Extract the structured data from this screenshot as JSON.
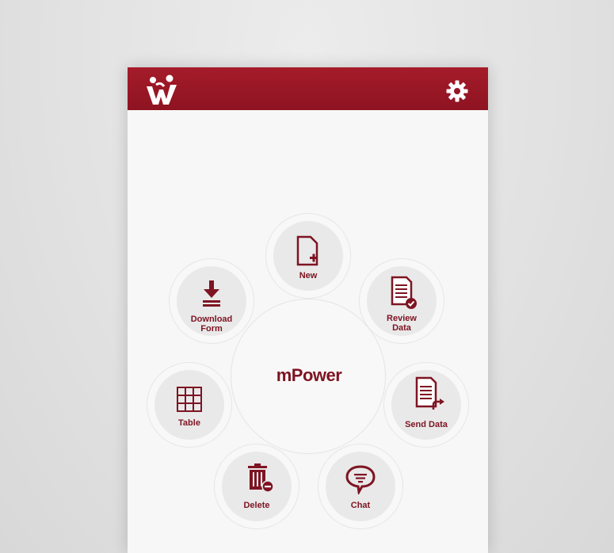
{
  "app": {
    "brand_name": "mPower"
  },
  "header": {
    "logo_icon": "mpower-people-logo-icon",
    "settings_icon": "gear-icon"
  },
  "menu": {
    "items": [
      {
        "label": "New",
        "icon": "new-document-icon"
      },
      {
        "label": "Download Form",
        "icon": "download-icon"
      },
      {
        "label": "Review Data",
        "icon": "review-document-check-icon"
      },
      {
        "label": "Table",
        "icon": "table-grid-icon"
      },
      {
        "label": "Send Data",
        "icon": "send-document-icon"
      },
      {
        "label": "Delete",
        "icon": "trash-icon"
      },
      {
        "label": "Chat",
        "icon": "chat-bubble-icon"
      }
    ]
  },
  "colors": {
    "brand": "#8e1322",
    "icon": "#7e1422",
    "button_bg": "#e9e9e9",
    "page_bg": "#f7f7f7"
  }
}
